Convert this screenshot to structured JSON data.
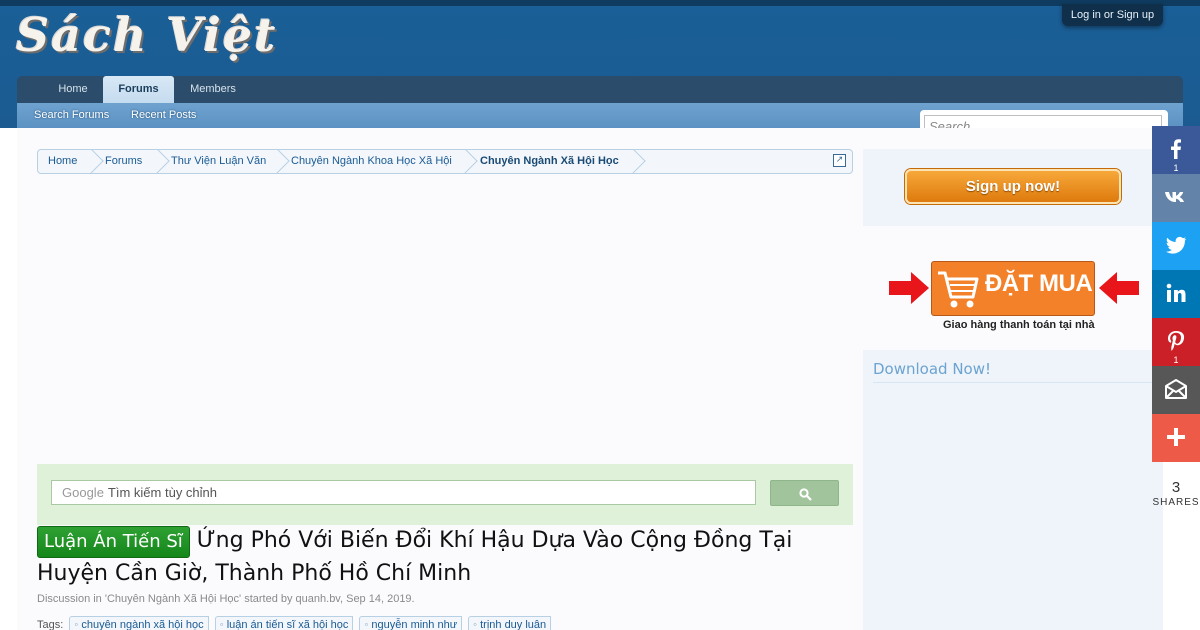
{
  "site": {
    "logo_text": "Sách Việt",
    "login_label": "Log in or Sign up"
  },
  "nav": {
    "tabs": [
      {
        "label": "Home"
      },
      {
        "label": "Forums"
      },
      {
        "label": "Members"
      }
    ],
    "active_tab": "Forums",
    "subnav": [
      {
        "label": "Search Forums"
      },
      {
        "label": "Recent Posts"
      }
    ]
  },
  "search": {
    "placeholder": "Search..."
  },
  "breadcrumb": [
    {
      "label": "Home"
    },
    {
      "label": "Forums"
    },
    {
      "label": "Thư Viện Luận Văn"
    },
    {
      "label": "Chuyên Ngành Khoa Học Xã Hội"
    },
    {
      "label": "Chuyên Ngành Xã Hội Học"
    }
  ],
  "custom_search": {
    "brand": "Google",
    "placeholder": "Tìm kiếm tùy chỉnh"
  },
  "thread": {
    "prefix": "Luận Án Tiến Sĩ",
    "title": "Ứng Phó Với Biến Đổi Khí Hậu Dựa Vào Cộng Đồng Tại Huyện Cần Giờ, Thành Phố Hồ Chí Minh",
    "meta": "Discussion in 'Chuyên Ngành Xã Hội Học' started by quanh.bv, Sep 14, 2019.",
    "tags_label": "Tags:",
    "tags": [
      "chuyên ngành xã hội học",
      "luận án tiến sĩ xã hội học",
      "nguyễn minh như",
      "trịnh duy luân"
    ]
  },
  "sidebar": {
    "signup_label": "Sign up now!",
    "order_label": "ĐẶT MUA",
    "order_sub": "Giao hàng thanh toán tại nhà",
    "download_title": "Download Now!"
  },
  "share": {
    "buttons": [
      {
        "name": "facebook",
        "color": "#3b5998",
        "count": "1"
      },
      {
        "name": "vk",
        "color": "#6383a8",
        "count": ""
      },
      {
        "name": "twitter",
        "color": "#1da1f2",
        "count": ""
      },
      {
        "name": "linkedin",
        "color": "#0077b5",
        "count": ""
      },
      {
        "name": "pinterest",
        "color": "#cb2027",
        "count": "1"
      },
      {
        "name": "email",
        "color": "#575757",
        "count": ""
      },
      {
        "name": "more",
        "color": "#ee5a48",
        "count": ""
      }
    ],
    "total": "3",
    "total_label": "SHARES"
  },
  "colors": {
    "header": "#1b5b91",
    "navbar": "#2b4d6b",
    "subnav": "#5b92c3",
    "prefix_green": "#15861a",
    "signup_orange": "#de7a0d"
  }
}
